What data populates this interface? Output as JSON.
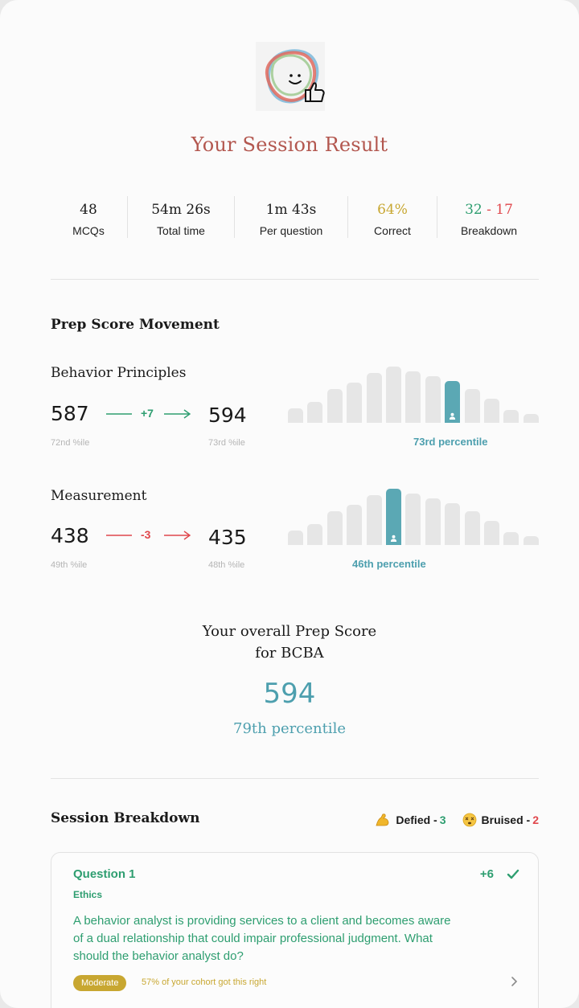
{
  "header": {
    "title": "Your Session Result",
    "logo_icon": "smiley-thumbs-up-icon"
  },
  "stats": [
    {
      "value": "48",
      "label": "MCQs"
    },
    {
      "value": "54m 26s",
      "label": "Total time"
    },
    {
      "value": "1m 43s",
      "label": "Per question"
    },
    {
      "value": "64%",
      "label": "Correct",
      "color": "#c8a731"
    },
    {
      "value_correct": "32",
      "value_sep": " - ",
      "value_incorrect": "17",
      "label": "Breakdown"
    }
  ],
  "prep": {
    "heading": "Prep Score Movement",
    "subjects": [
      {
        "name": "Behavior Principles",
        "from_score": "587",
        "from_ile": "72nd %ile",
        "delta": "+7",
        "to_score": "594",
        "to_ile": "73rd %ile",
        "percentile_label": "73rd percentile",
        "highlight_index": 8,
        "color": "#2e9e70"
      },
      {
        "name": "Measurement",
        "from_score": "438",
        "from_ile": "49th %ile",
        "delta": "-3",
        "to_score": "435",
        "to_ile": "48th %ile",
        "percentile_label": "46th percentile",
        "highlight_index": 5,
        "color": "#e0474c"
      }
    ]
  },
  "overall": {
    "line1": "Your overall Prep Score",
    "line2": "for BCBA",
    "score": "594",
    "percentile": "79th percentile"
  },
  "breakdown": {
    "heading": "Session Breakdown",
    "defied_label": "Defied -",
    "defied_count": "3",
    "bruised_label": "Bruised -",
    "bruised_count": "2",
    "defied_icon": "flexed-biceps-icon",
    "bruised_icon": "dizzy-face-icon",
    "question": {
      "title": "Question 1",
      "topic": "Ethics",
      "text": "A behavior analyst is providing services to a client and becomes aware of a dual relationship that could impair professional judgment. What should the behavior analyst do?",
      "points": "+6",
      "difficulty": "Moderate",
      "cohort": "57% of your cohort got this right"
    }
  }
}
